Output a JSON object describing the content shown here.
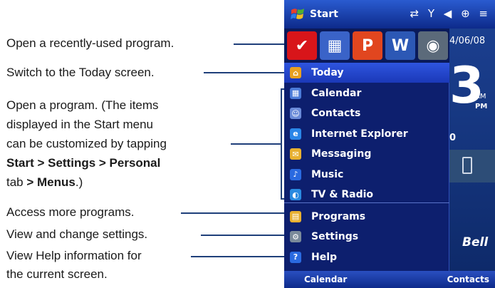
{
  "callouts": {
    "recent": "Open a recently-used program.",
    "today": "Switch to the Today screen.",
    "program_line1": "Open a program. (The items",
    "program_line2": "displayed in the Start menu",
    "program_line3": "can be customized by tapping",
    "program_line4": "Start > Settings > Personal",
    "program_line5a": "tab ",
    "program_line5b": "> Menus",
    "program_line5c": ".)",
    "more": "Access more programs.",
    "settings": "View and change settings.",
    "help_line1": "View Help information for",
    "help_line2": "the current screen."
  },
  "device": {
    "title": "Start",
    "status_icons": "⇄ Y ◀ ⊕ ≡",
    "date": "4/06/08",
    "big_digit": "3",
    "am": "AM",
    "pm": "PM",
    "calls": "0",
    "brand": "Bell",
    "recent_apps": [
      {
        "name": "pdf-icon",
        "glyph": "✔",
        "color": "#d8151a"
      },
      {
        "name": "calendar-app-icon",
        "glyph": "▦",
        "color": "#3a63c8"
      },
      {
        "name": "powerpoint-icon",
        "glyph": "P",
        "color": "#e1461f"
      },
      {
        "name": "word-icon",
        "glyph": "W",
        "color": "#2c58b5"
      },
      {
        "name": "camera-icon",
        "glyph": "◉",
        "color": "#5b6a7a"
      }
    ],
    "menu_items": [
      {
        "label": "Today",
        "icon": "today-icon",
        "glyph": "⌂",
        "color": "#e8a020",
        "selected": true
      },
      {
        "label": "Calendar",
        "icon": "calendar-icon",
        "glyph": "▦",
        "color": "#4a7ad8"
      },
      {
        "label": "Contacts",
        "icon": "contacts-icon",
        "glyph": "☺",
        "color": "#6a8ad8"
      },
      {
        "label": "Internet Explorer",
        "icon": "internet-explorer-icon",
        "glyph": "e",
        "color": "#2a86e8"
      },
      {
        "label": "Messaging",
        "icon": "messaging-icon",
        "glyph": "✉",
        "color": "#e8b030"
      },
      {
        "label": "Music",
        "icon": "music-icon",
        "glyph": "♪",
        "color": "#2a6ae0"
      },
      {
        "label": "TV & Radio",
        "icon": "tv-radio-icon",
        "glyph": "◐",
        "color": "#2a8ae0"
      },
      {
        "label": "Programs",
        "icon": "programs-icon",
        "glyph": "▤",
        "color": "#e8b030"
      },
      {
        "label": "Settings",
        "icon": "settings-icon",
        "glyph": "⚙",
        "color": "#7a8a9a"
      },
      {
        "label": "Help",
        "icon": "help-icon",
        "glyph": "?",
        "color": "#2a6ae0"
      }
    ],
    "soft_left": "Calendar",
    "soft_right": "Contacts"
  }
}
